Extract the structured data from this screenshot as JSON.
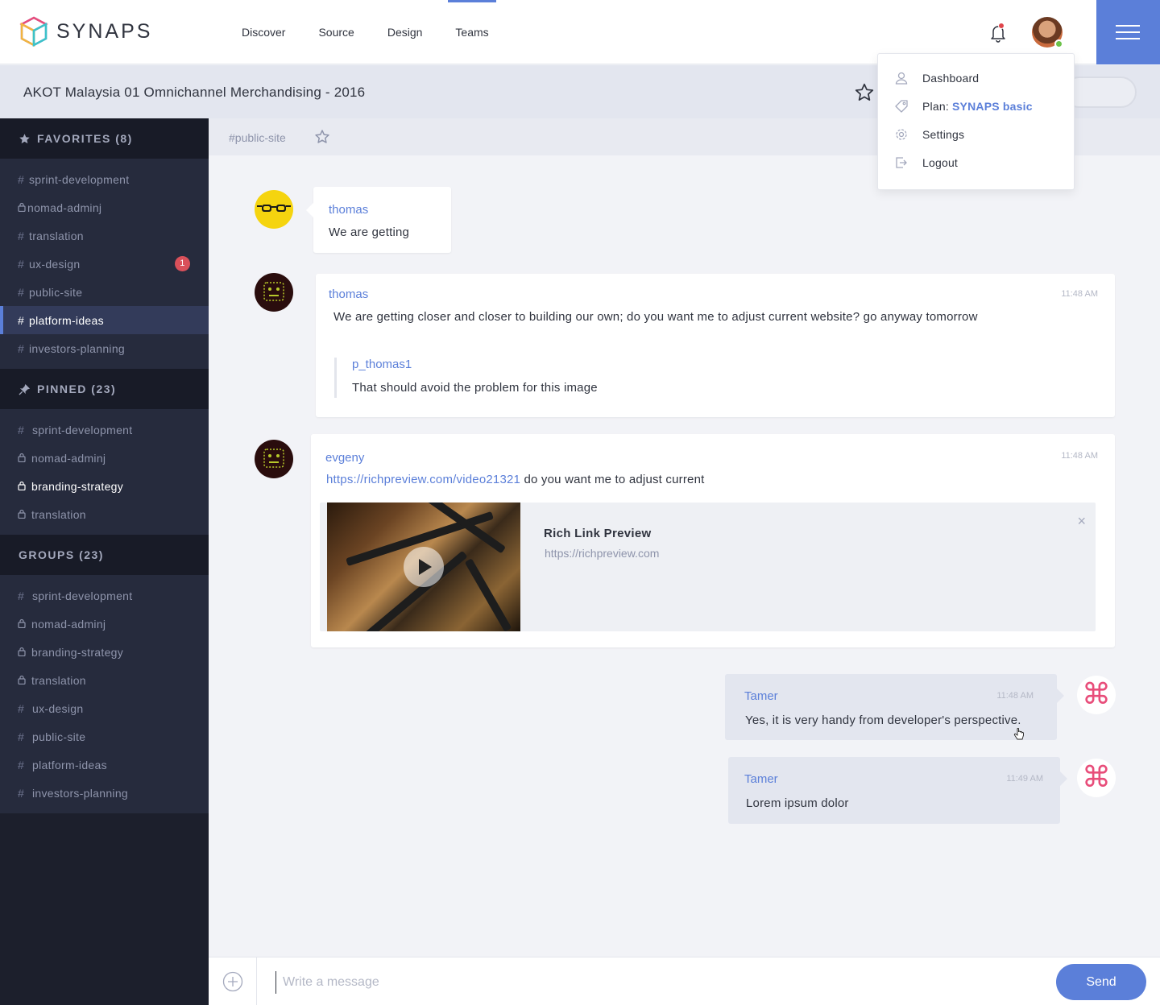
{
  "app": {
    "brand": "SYNAPS"
  },
  "nav": {
    "items": [
      "Discover",
      "Source",
      "Design",
      "Teams"
    ],
    "active": "Teams"
  },
  "header": {
    "project_title": "AKOT Malaysia 01 Omnichannel Merchandising - 2016"
  },
  "sidebar": {
    "favorites": {
      "title": "FAVORITES (8)",
      "items": [
        {
          "prefix": "#",
          "label": "sprint-development"
        },
        {
          "prefix": "lock",
          "label": "nomad-adminj"
        },
        {
          "prefix": "#",
          "label": "translation"
        },
        {
          "prefix": "#",
          "label": "ux-design",
          "badge": "1"
        },
        {
          "prefix": "#",
          "label": "public-site"
        },
        {
          "prefix": "#",
          "label": "platform-ideas",
          "active": true
        },
        {
          "prefix": "#",
          "label": "investors-planning"
        }
      ]
    },
    "pinned": {
      "title": "PINNED (23)",
      "items": [
        {
          "prefix": "#",
          "label": "sprint-development"
        },
        {
          "prefix": "lock",
          "label": "nomad-adminj"
        },
        {
          "prefix": "lock",
          "label": "branding-strategy",
          "highlight": true
        },
        {
          "prefix": "lock",
          "label": "translation"
        }
      ]
    },
    "groups": {
      "title": "GROUPS (23)",
      "items": [
        {
          "prefix": "#",
          "label": "sprint-development"
        },
        {
          "prefix": "lock",
          "label": "nomad-adminj"
        },
        {
          "prefix": "lock",
          "label": "branding-strategy"
        },
        {
          "prefix": "lock",
          "label": "translation"
        },
        {
          "prefix": "#",
          "label": "ux-design"
        },
        {
          "prefix": "#",
          "label": "public-site"
        },
        {
          "prefix": "#",
          "label": "platform-ideas"
        },
        {
          "prefix": "#",
          "label": "investors-planning"
        }
      ]
    }
  },
  "channel": {
    "name": "#public-site"
  },
  "messages": {
    "m1": {
      "author": "thomas",
      "text": "We are getting"
    },
    "m2": {
      "author": "thomas",
      "time": "11:48 AM",
      "text": "We are getting closer and closer to building our own; do you want me to adjust current website? go anyway tomorrow",
      "quote_author": "p_thomas1",
      "quote_text": "That should avoid the problem for this image"
    },
    "m3": {
      "author": "evgeny",
      "time": "11:48 AM",
      "link": "https://richpreview.com/video21321",
      "text": "do you want me to adjust current",
      "preview_title": "Rich Link Preview",
      "preview_url": "https://richpreview.com",
      "close": "×"
    },
    "m4": {
      "author": "Tamer",
      "time": "11:48 AM",
      "text": "Yes, it is very handy from developer's perspective."
    },
    "m5": {
      "author": "Tamer",
      "time": "11:49 AM",
      "text": "Lorem ipsum dolor"
    }
  },
  "dropdown": {
    "dashboard": "Dashboard",
    "plan_label": "Plan:",
    "plan_value": "SYNAPS basic",
    "settings": "Settings",
    "logout": "Logout"
  },
  "composer": {
    "placeholder": "Write a message",
    "send": "Send"
  },
  "colors": {
    "accent": "#5b7fd9",
    "sidebar": "#262b3d",
    "badge": "#d9505a",
    "online": "#6cc24a"
  },
  "icons": [
    "synaps-logo",
    "bell-icon",
    "menu-icon",
    "star-icon",
    "lock-icon",
    "pin-icon",
    "user-icon",
    "tag-icon",
    "gear-icon",
    "logout-icon",
    "plus-circle-icon",
    "play-icon",
    "close-icon",
    "command-icon"
  ]
}
